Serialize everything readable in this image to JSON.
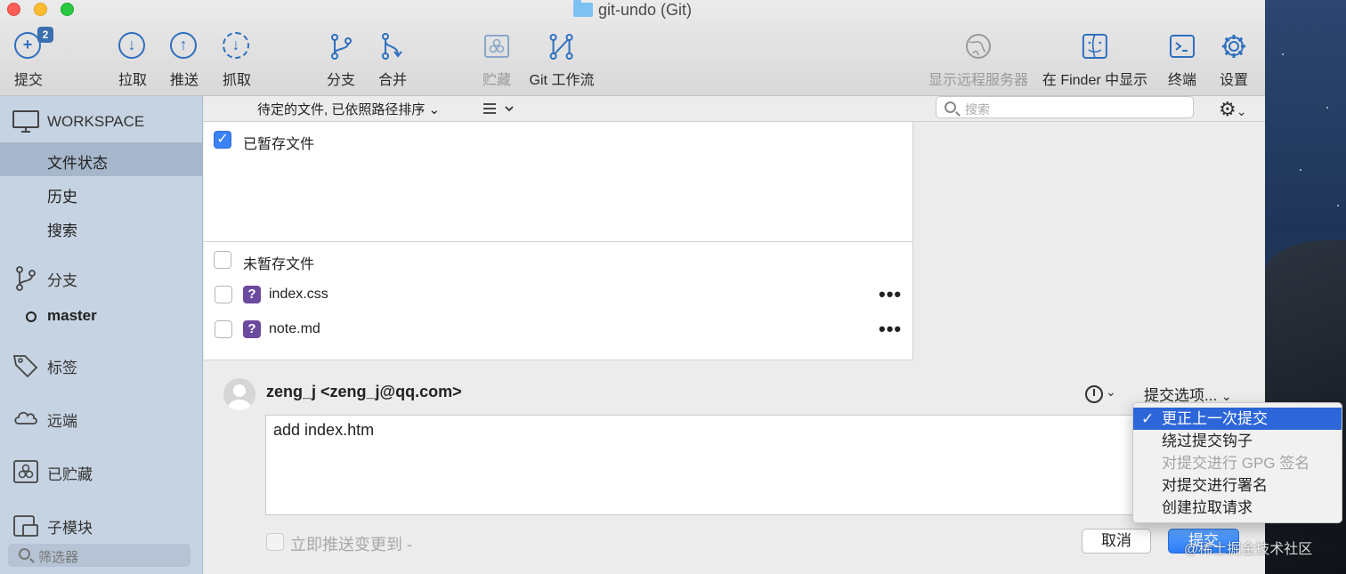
{
  "window": {
    "title": "git-undo (Git)"
  },
  "toolbar": {
    "commit": {
      "label": "提交",
      "badge": "2"
    },
    "pull": {
      "label": "拉取"
    },
    "push": {
      "label": "推送"
    },
    "fetch": {
      "label": "抓取"
    },
    "branch": {
      "label": "分支"
    },
    "merge": {
      "label": "合并"
    },
    "stash": {
      "label": "贮藏"
    },
    "gitflow": {
      "label": "Git 工作流"
    },
    "remote": {
      "label": "显示远程服务器"
    },
    "finder": {
      "label": "在 Finder 中显示"
    },
    "terminal": {
      "label": "终端"
    },
    "settings": {
      "label": "设置"
    }
  },
  "sidebar": {
    "workspace": "WORKSPACE",
    "file_status": "文件状态",
    "history": "历史",
    "search": "搜索",
    "branches": "分支",
    "current_branch": "master",
    "tags": "标签",
    "remotes": "远端",
    "stashes": "已贮藏",
    "submodules": "子模块",
    "filter_placeholder": "筛选器"
  },
  "file_list": {
    "sort_label": "待定的文件, 已依照路径排序",
    "search_placeholder": "搜索",
    "staged_header": "已暂存文件",
    "unstaged_header": "未暂存文件",
    "unstaged_files": [
      {
        "name": "index.css",
        "status_icon": "?"
      },
      {
        "name": "note.md",
        "status_icon": "?"
      }
    ],
    "more_glyph": "•••"
  },
  "commit": {
    "author": "zeng_j <zeng_j@qq.com>",
    "options_label": "提交选项...",
    "message": "add index.htm",
    "push_immediately_label": "立即推送变更到 -",
    "cancel_label": "取消",
    "commit_label": "提交"
  },
  "commit_options_menu": {
    "items": [
      {
        "label": "更正上一次提交",
        "checked": true,
        "enabled": true
      },
      {
        "label": "绕过提交钩子",
        "checked": false,
        "enabled": true
      },
      {
        "label": "对提交进行 GPG 签名",
        "checked": false,
        "enabled": false
      },
      {
        "label": "对提交进行署名",
        "checked": false,
        "enabled": true
      },
      {
        "label": "创建拉取请求",
        "checked": false,
        "enabled": true
      }
    ],
    "check_glyph": "✓"
  },
  "watermark": "@稀土掘金技术社区",
  "colors": {
    "accent": "#2c66d8",
    "sidebar": "#c6d3e2",
    "icon_blue": "#2f6fbf",
    "unknown_file": "#6b4aa0"
  }
}
